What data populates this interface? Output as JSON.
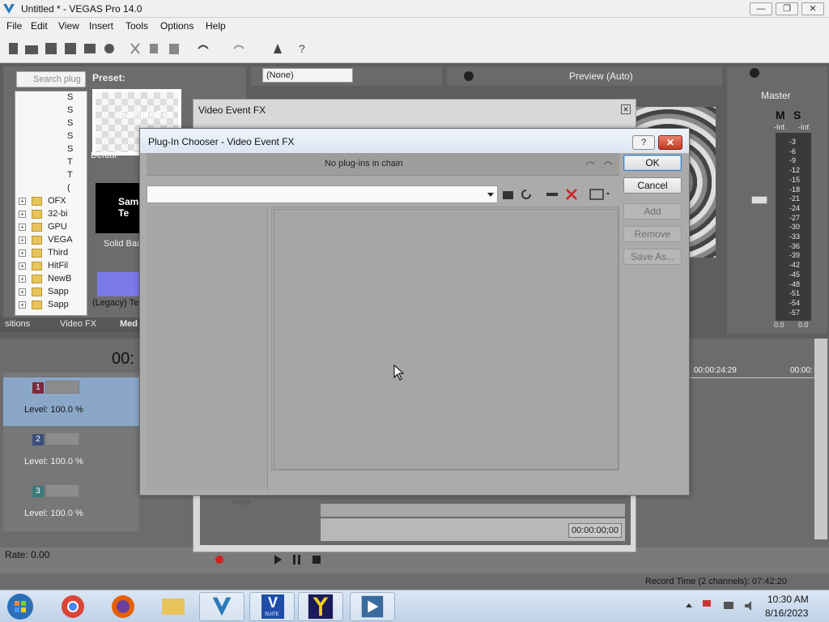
{
  "window": {
    "title": "Untitled * - VEGAS Pro 14.0",
    "min": "—",
    "restore": "❐",
    "close": "✕"
  },
  "menu": [
    "File",
    "Edit",
    "View",
    "Insert",
    "Tools",
    "Options",
    "Help"
  ],
  "explorer": {
    "search_placeholder": "Search plug",
    "tree": [
      "S",
      "S",
      "S",
      "S",
      "S",
      "T",
      "T",
      "(",
      "OFX",
      "32-bi",
      "GPU",
      "VEGA",
      "Third",
      "HitFil",
      "NewB",
      "Sapp",
      "Sapp"
    ],
    "preset_label": "Preset:",
    "presets": [
      {
        "thumb_text": "Sample Tex",
        "caption": "Defaul"
      },
      {
        "thumb_text": "Sam Te",
        "caption": "Solid Bac"
      },
      {
        "thumb_text": "",
        "caption": "(Legacy) Te"
      }
    ]
  },
  "tabs": [
    "sitions",
    "Video FX",
    "Med"
  ],
  "trimmer": {
    "select_value": "(None)"
  },
  "preview": {
    "label": "Preview (Auto)"
  },
  "master": {
    "label": "Master",
    "ms_buttons": [
      "M",
      "S"
    ],
    "inf_left": "-Inf.",
    "inf_right": "-Inf.",
    "scale": [
      "3",
      "6",
      "9",
      "12",
      "15",
      "18",
      "21",
      "24",
      "27",
      "30",
      "33",
      "36",
      "39",
      "42",
      "45",
      "48",
      "51",
      "54",
      "57"
    ],
    "bottom_left": "0.0",
    "bottom_right": "0.0"
  },
  "timeline": {
    "time_display": "00:",
    "ruler_time": "00:00:24:29",
    "ruler_time2": "00:00:",
    "tracks": [
      {
        "number": "1",
        "level": "Level: 100.0 %",
        "color": "#7a2a3a"
      },
      {
        "number": "2",
        "level": "Level: 100.0 %",
        "color": "#3a4c7a"
      },
      {
        "number": "3",
        "level": "Level: 100.0 %",
        "color": "#3a7a7a"
      }
    ]
  },
  "transport": {
    "rate": "Rate: 0.00"
  },
  "status": {
    "record_time": "Record Time (2 channels): 07:42:20"
  },
  "video_event_fx": {
    "title": "Video Event FX",
    "close": "✕",
    "time": "00:00:00;00",
    "mini_label": "Mask"
  },
  "plugin_chooser": {
    "title": "Plug-In Chooser - Video Event FX",
    "help": "?",
    "close": "✕",
    "chain_text": "No plug-ins in chain",
    "buttons": {
      "ok": "OK",
      "cancel": "Cancel",
      "add": "Add",
      "remove": "Remove",
      "save_as": "Save As..."
    }
  },
  "taskbar": {
    "time": "10:30 AM",
    "date": "8/16/2023",
    "suite_label": "SUITE"
  },
  "colors": {
    "accent": "#3b7fc4",
    "dialog_bg": "#ababab",
    "timeline_bg": "#6c6c6c"
  }
}
